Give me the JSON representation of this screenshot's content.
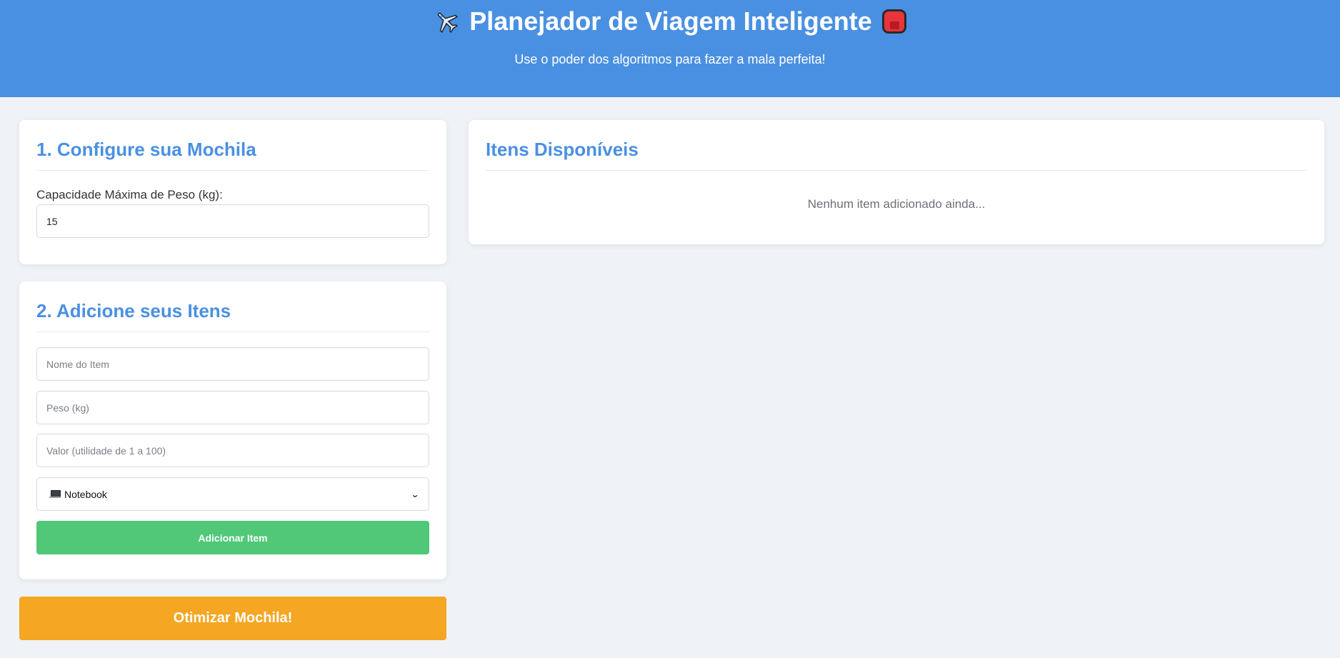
{
  "header": {
    "title": "Planejador de Viagem Inteligente",
    "subtitle": "Use o poder dos algoritmos para fazer a mala perfeita!",
    "icons": [
      "airplane-icon",
      "backpack-icon"
    ],
    "background": "#4a90e2"
  },
  "config": {
    "title": "1. Configure sua Mochila",
    "capacity_label": "Capacidade Máxima de Peso (kg):",
    "capacity_value": "15"
  },
  "items_form": {
    "title": "2. Adicione seus Itens",
    "name_placeholder": "Nome do Item",
    "weight_placeholder": "Peso (kg)",
    "value_placeholder": "Valor (utilidade de 1 a 100)",
    "icon_select": {
      "selected": "Notebook",
      "selected_icon": "laptop-icon"
    },
    "add_button": "Adicionar Item",
    "add_button_color": "#50c878"
  },
  "optimize_button": "Otimizar Mochila!",
  "optimize_button_color": "#f5a623",
  "available": {
    "title": "Itens Disponíveis",
    "empty_message": "Nenhum item adicionado ainda..."
  },
  "accent_color": "#4a90e2"
}
